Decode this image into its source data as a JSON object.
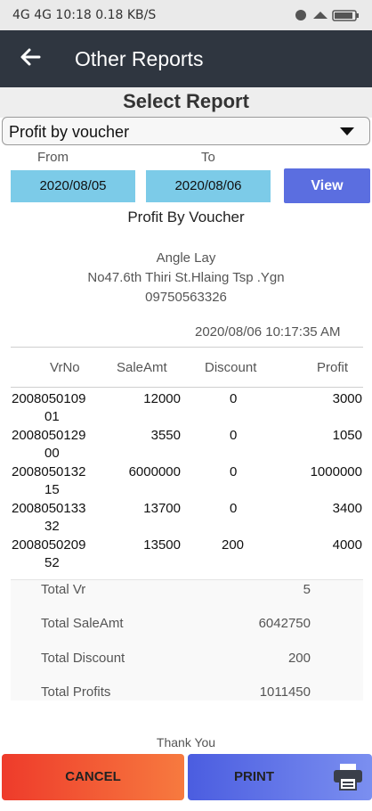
{
  "status_bar": {
    "left": "4G 4G 10:18 0.18 KB/S",
    "time": "10:18"
  },
  "app_bar": {
    "title": "Other Reports"
  },
  "select_report": {
    "heading": "Select Report",
    "selected": "Profit by voucher",
    "from_label": "From",
    "to_label": "To",
    "from_date": "2020/08/05",
    "to_date": "2020/08/06",
    "view_label": "View"
  },
  "report": {
    "title": "Profit By Voucher",
    "shop_name": "Angle Lay",
    "address": "No47.6th Thiri St.Hlaing Tsp .Ygn",
    "phone": "09750563326",
    "datetime": "2020/08/06  10:17:35 AM",
    "columns": [
      "VrNo",
      "SaleAmt",
      "Discount",
      "Profit"
    ],
    "rows": [
      {
        "vr1": "2008050109",
        "vr2": "01",
        "sale": "12000",
        "discount": "0",
        "profit": "3000"
      },
      {
        "vr1": "2008050129",
        "vr2": "00",
        "sale": "3550",
        "discount": "0",
        "profit": "1050"
      },
      {
        "vr1": "2008050132",
        "vr2": "15",
        "sale": "6000000",
        "discount": "0",
        "profit": "1000000"
      },
      {
        "vr1": "2008050133",
        "vr2": "32",
        "sale": "13700",
        "discount": "0",
        "profit": "3400"
      },
      {
        "vr1": "2008050209",
        "vr2": "52",
        "sale": "13500",
        "discount": "200",
        "profit": "4000"
      }
    ],
    "totals": [
      {
        "label": "Total Vr",
        "value": "5"
      },
      {
        "label": "Total SaleAmt",
        "value": "6042750"
      },
      {
        "label": "Total Discount",
        "value": "200"
      },
      {
        "label": "Total Profits",
        "value": "1011450"
      }
    ],
    "footer": "Thank You"
  },
  "actions": {
    "cancel": "CANCEL",
    "print": "PRINT"
  },
  "colors": {
    "app_bar": "#2f3640",
    "date_box": "#7ccbe8",
    "view_button": "#5b6ee0",
    "cancel": "#ee4a2e",
    "print": "#5b6ee0"
  }
}
